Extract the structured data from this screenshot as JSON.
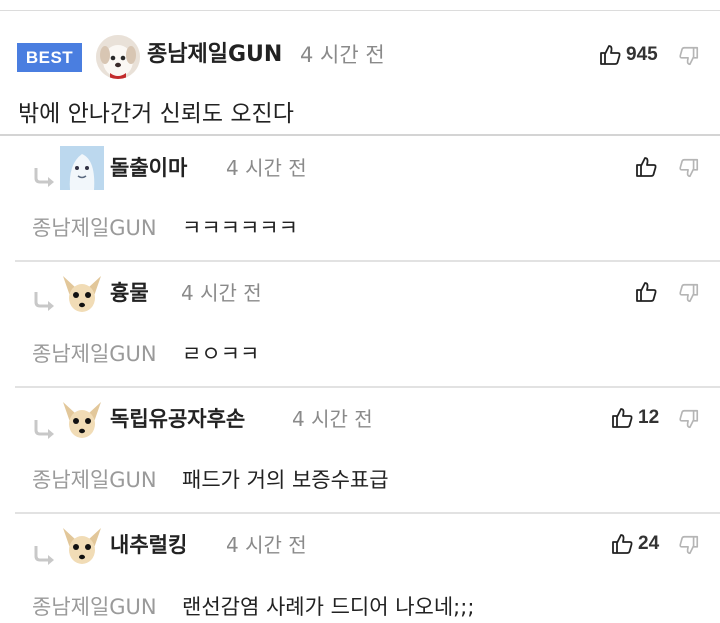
{
  "colors": {
    "badge": "#4a7ee0",
    "muted": "#8a8a8a",
    "separator": "#d4d4d4"
  },
  "best_comment": {
    "badge": "BEST",
    "author": "종남제일GUN",
    "time": "4 시간 전",
    "likes": "945",
    "body": "밖에 안나간거 신뢰도 오진다",
    "avatar_icon": "white-dog-avatar"
  },
  "replies": [
    {
      "author": "돌출이마",
      "time": "4 시간 전",
      "likes": "",
      "mention": "종남제일GUN",
      "text": "ㅋㅋㅋㅋㅋㅋ",
      "avatar_icon": "blue-character-avatar"
    },
    {
      "author": "흉물",
      "time": "4 시간 전",
      "likes": "",
      "mention": "종남제일GUN",
      "text": "ㄹㅇㅋㅋ",
      "avatar_icon": "chihuahua-avatar"
    },
    {
      "author": "독립유공자후손",
      "time": "4 시간 전",
      "likes": "12",
      "mention": "종남제일GUN",
      "text": "패드가 거의 보증수표급",
      "avatar_icon": "chihuahua-avatar"
    },
    {
      "author": "내추럴킹",
      "time": "4 시간 전",
      "likes": "24",
      "mention": "종남제일GUN",
      "text": "랜선감염 사례가 드디어 나오네;;;",
      "avatar_icon": "chihuahua-avatar"
    }
  ]
}
